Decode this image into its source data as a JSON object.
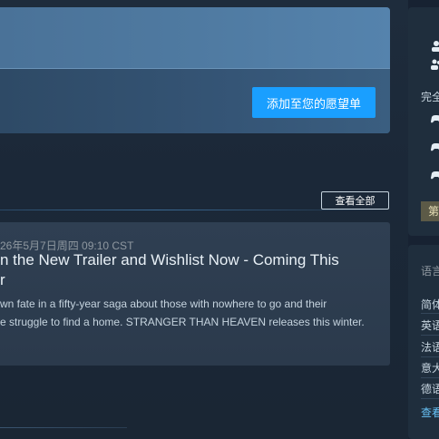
{
  "wishlist": {
    "add_button": "添加至您的愿望单"
  },
  "news": {
    "see_all": "查看全部",
    "date": "26年5月7日周四 09:10 CST",
    "title_line1": "n the New Trailer and Wishlist Now - Coming This",
    "title_line2": "r",
    "body_line1": "wn fate in a fifty-year saga about those with nowhere to go and their",
    "body_line2": "e struggle to find a home. STRANGER THAN HEAVEN releases this winter."
  },
  "sidebar": {
    "icons": [
      "person-icon",
      "people-icon"
    ],
    "controller_label": "完全",
    "controller_icons": [
      "gamepad-icon",
      "gamepad-icon",
      "gamepad-icon"
    ],
    "badge": "第",
    "languages_heading": "语言",
    "languages": [
      "简体",
      "英语",
      "法语",
      "意大",
      "德语"
    ],
    "see_all_link": "查看"
  },
  "colors": {
    "accent": "#1a9fff",
    "background": "#1b2838",
    "link": "#67c1f5"
  }
}
